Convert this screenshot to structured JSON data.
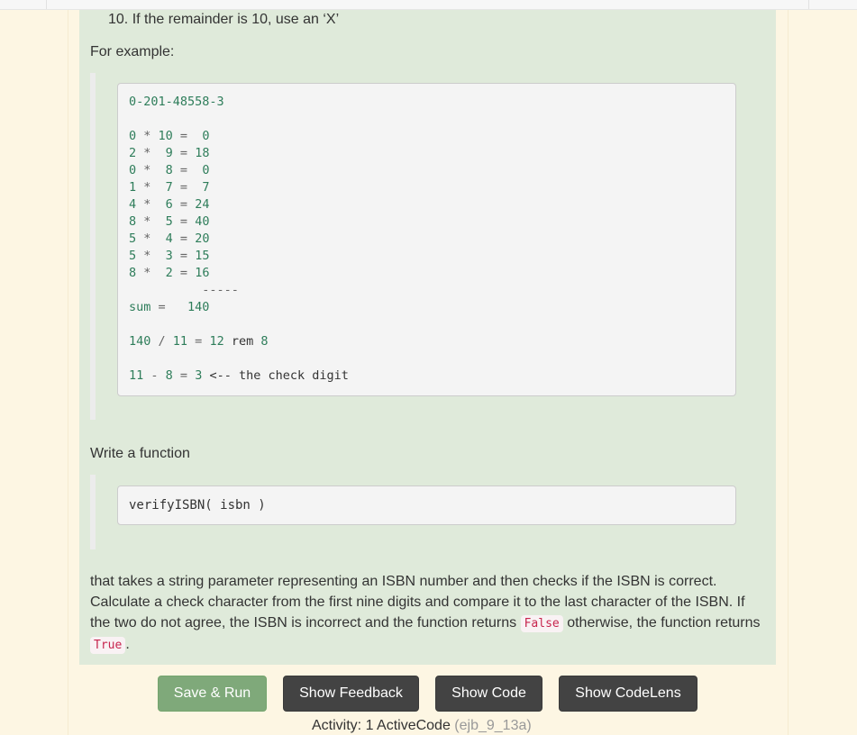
{
  "question": {
    "list_item": "10. If the remainder is 10, use an ‘X’",
    "for_example": "For example:",
    "example_code": {
      "isbn": "0-201-48558-3",
      "rows": [
        {
          "digit": "0",
          "weight": "10",
          "product": " 0"
        },
        {
          "digit": "2",
          "weight": " 9",
          "product": "18"
        },
        {
          "digit": "0",
          "weight": " 8",
          "product": " 0"
        },
        {
          "digit": "1",
          "weight": " 7",
          "product": " 7"
        },
        {
          "digit": "4",
          "weight": " 6",
          "product": "24"
        },
        {
          "digit": "8",
          "weight": " 5",
          "product": "40"
        },
        {
          "digit": "5",
          "weight": " 4",
          "product": "20"
        },
        {
          "digit": "5",
          "weight": " 3",
          "product": "15"
        },
        {
          "digit": "8",
          "weight": " 2",
          "product": "16"
        }
      ],
      "dashes": "          -----",
      "sum_line": "sum =   140",
      "div_line": "140 / 11 = 12 rem 8",
      "check_line": "11 - 8 = 3 <-- the check digit"
    },
    "write_function": "Write a function",
    "function_signature": "verifyISBN( isbn )",
    "description_part1": "that takes a string parameter representing an ISBN number and then checks if the ISBN is correct. Calculate a check character from the first nine digits and compare it to the last character of the ISBN. If the two do not agree, the ISBN is incorrect and the function returns ",
    "false_literal": "False",
    "description_part2": " otherwise, the function returns ",
    "true_literal": "True",
    "description_part3": "."
  },
  "buttons": {
    "save_run": "Save & Run",
    "show_feedback": "Show Feedback",
    "show_code": "Show Code",
    "show_codelens": "Show CodeLens"
  },
  "activity": {
    "label": "Activity: 1 ActiveCode",
    "div_id": "(ejb_9_13a)"
  }
}
